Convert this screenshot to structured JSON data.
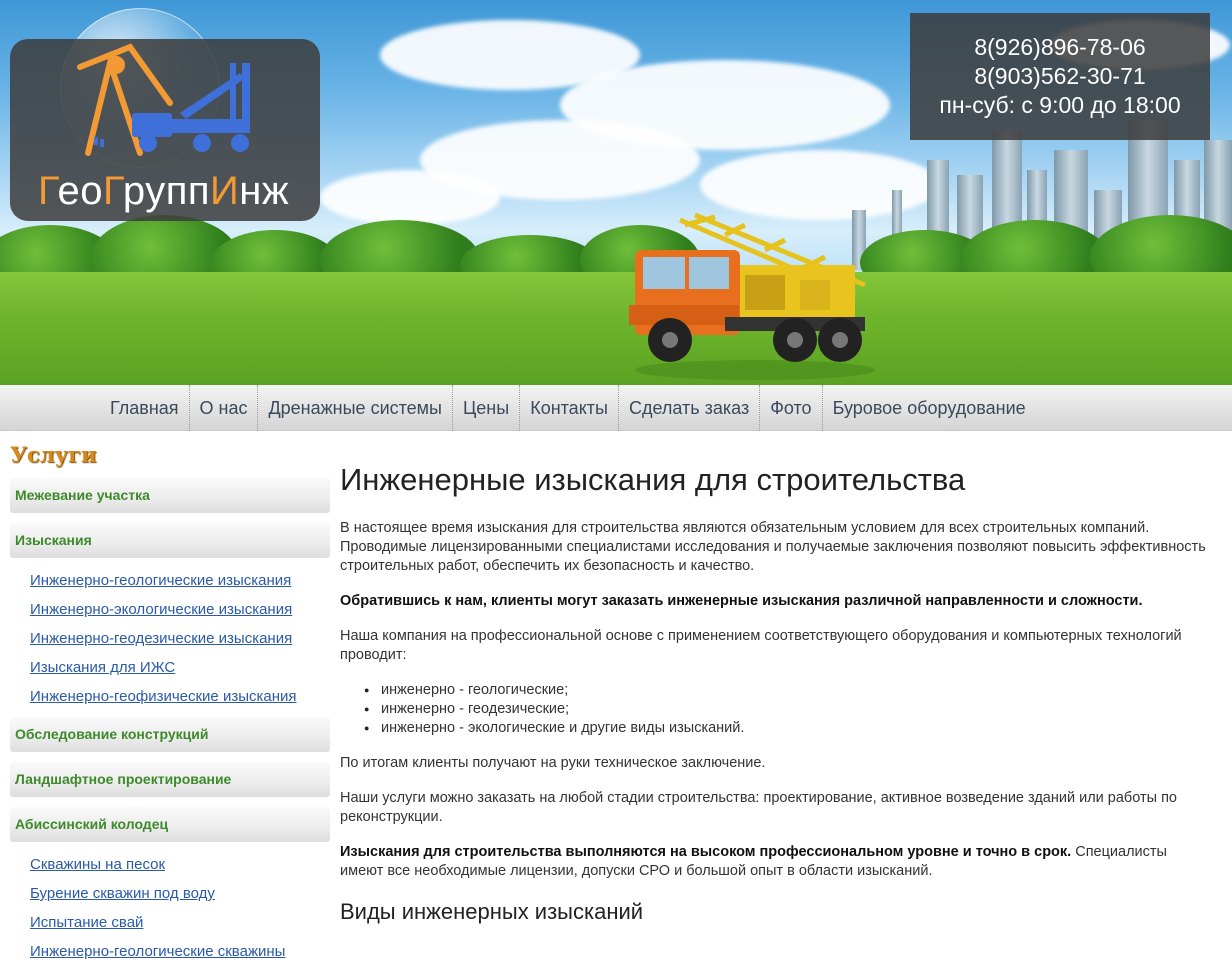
{
  "logo": {
    "part1_hl": "Г",
    "part1": "ео",
    "part2_hl": "Г",
    "part2": "рупп",
    "part3_hl": "И",
    "part3": "нж"
  },
  "contacts": {
    "phone1": "8(926)896-78-06",
    "phone2": "8(903)562-30-71",
    "hours": "пн-суб: с 9:00 до 18:00"
  },
  "nav": {
    "items": [
      {
        "label": "Главная"
      },
      {
        "label": "О нас"
      },
      {
        "label": "Дренажные системы"
      },
      {
        "label": "Цены"
      },
      {
        "label": "Контакты"
      },
      {
        "label": "Сделать заказ"
      },
      {
        "label": "Фото"
      },
      {
        "label": "Буровое оборудование"
      }
    ]
  },
  "sidebar": {
    "title": "Услуги",
    "categories": [
      {
        "label": "Межевание участка"
      },
      {
        "label": "Изыскания",
        "children": [
          "Инженерно-геологические изыскания",
          "Инженерно-экологические изыскания",
          "Инженерно-геодезические изыскания",
          "Изыскания для ИЖС",
          "Инженерно-геофизические изыскания"
        ]
      },
      {
        "label": "Обследование конструкций"
      },
      {
        "label": "Ландшафтное проектирование"
      },
      {
        "label": "Абиссинский колодец",
        "children": [
          "Скважины на песок",
          "Бурение скважин под воду",
          "Испытание свай",
          "Инженерно-геологические скважины"
        ]
      }
    ]
  },
  "content": {
    "title": "Инженерные изыскания для строительства",
    "p1": "В настоящее время изыскания для строительства являются обязательным условием для всех строительных компаний. Проводимые лицензированными специалистами исследования и получаемые заключения позволяют повысить эффективность строительных работ, обеспечить их безопасность и качество.",
    "p2_bold": "Обратившись к нам, клиенты могут заказать инженерные изыскания различной направленности и сложности.",
    "p3": "Наша компания на профессиональной основе с применением соответствующего оборудования и компьютерных технологий проводит:",
    "list": [
      "инженерно - геологические;",
      "инженерно - геодезические;",
      "инженерно - экологические и другие виды изысканий."
    ],
    "p4": "По итогам клиенты получают на руки техническое заключение.",
    "p5": "Наши услуги можно заказать на любой стадии строительства: проектирование, активное возведение зданий или работы по реконструкции.",
    "p6_bold": "Изыскания для строительства выполняются на высоком профессиональном уровне и точно в срок.",
    "p6_rest": "Специалисты имеют все необходимые лицензии, допуски СРО и большой опыт в области изысканий.",
    "h2": "Виды инженерных изысканий"
  },
  "colors": {
    "accent_orange": "#f39a35",
    "logo_blue": "#3f6fd8",
    "menu_green": "#3d8a2b",
    "link_blue": "#2a5aa8",
    "sidebar_title": "#d58a1b"
  }
}
